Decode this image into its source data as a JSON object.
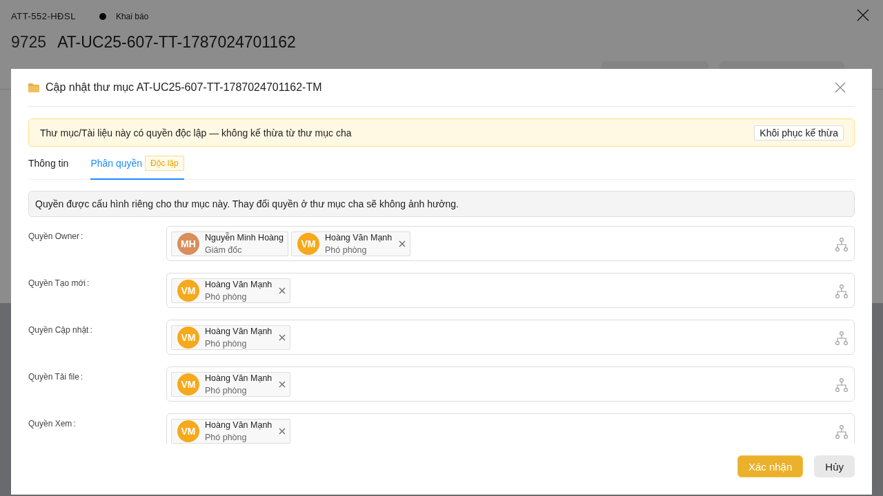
{
  "page": {
    "code": "ATT-552-HĐSL",
    "status": "Khai báo",
    "number": "9725",
    "title": "AT-UC25-607-TT-1787024701162"
  },
  "dialog": {
    "title": "Cập nhật thư mục AT-UC25-607-TT-1787024701162-TM",
    "alert": {
      "text": "Thư mục/Tài liệu này có quyền độc lập — không kế thừa từ thư mục cha",
      "action": "Khôi phục kế thừa"
    },
    "tabs": [
      {
        "label": "Thông tin",
        "selected": false
      },
      {
        "label": "Phân quyền",
        "selected": true,
        "badge": "Độc lập"
      }
    ],
    "info": "Quyền được cấu hình riêng cho thư mục này. Thay đổi quyền ở thư mục cha sẽ không ảnh hưởng.",
    "permissions": [
      {
        "label": "Quyền Owner",
        "separator": ":",
        "members": [
          {
            "initials": "MH",
            "name": "Nguyễn Minh Hoàng",
            "role": "Giám đốc",
            "color": "#d98e5c",
            "removable": false
          },
          {
            "initials": "VM",
            "name": "Hoàng Văn Mạnh",
            "role": "Phó phòng",
            "color": "#f5a91b",
            "removable": true
          }
        ]
      },
      {
        "label": "Quyền Tạo mới",
        "separator": ":",
        "members": [
          {
            "initials": "VM",
            "name": "Hoàng Văn Mạnh",
            "role": "Phó phòng",
            "color": "#f5a91b",
            "removable": true
          }
        ]
      },
      {
        "label": "Quyền Cập nhật",
        "separator": ":",
        "members": [
          {
            "initials": "VM",
            "name": "Hoàng Văn Mạnh",
            "role": "Phó phòng",
            "color": "#f5a91b",
            "removable": true
          }
        ]
      },
      {
        "label": "Quyền Tải file",
        "separator": ":",
        "members": [
          {
            "initials": "VM",
            "name": "Hoàng Văn Mạnh",
            "role": "Phó phòng",
            "color": "#f5a91b",
            "removable": true
          }
        ]
      },
      {
        "label": "Quyền Xem",
        "separator": ":",
        "members": [
          {
            "initials": "VM",
            "name": "Hoàng Văn Mạnh",
            "role": "Phó phòng",
            "color": "#f5a91b",
            "removable": true
          }
        ]
      }
    ],
    "buttons": [
      {
        "label": "Xác nhận",
        "kind": "primary"
      },
      {
        "label": "Hủy",
        "kind": "secondary"
      }
    ]
  }
}
